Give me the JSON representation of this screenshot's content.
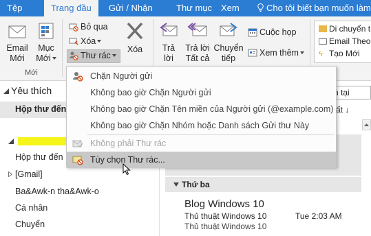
{
  "tabs": [
    "Tệp",
    "Trang đầu",
    "Gửi / Nhận",
    "Thư mục",
    "Xem"
  ],
  "tell_me": "Cho tôi biết bạn muốn làm",
  "ribbon": {
    "new_email": "Email\nMới",
    "new_items": "Mục\nMới",
    "group_new": "Mới",
    "ignore": "Bỏ qua",
    "clean_up": "Xóa",
    "junk": "Thư rác",
    "delete": "Xóa",
    "reply": "Trả\nlời",
    "reply_all": "Trả lời\nTất cả",
    "forward": "Chuyển\ntiếp",
    "meeting": "Cuộc họp",
    "more": "Xem thêm",
    "quick_steps": [
      "Di chuyển t",
      "Email Theo",
      "Tạo Mới"
    ]
  },
  "junk_menu": {
    "items": [
      {
        "label": "Chặn Người gửi",
        "state": "normal"
      },
      {
        "label": "Không bao giờ Chặn Người gửi",
        "state": "normal"
      },
      {
        "label": "Không bao giờ Chặn Tên miền của Người gửi (@example.com)",
        "state": "normal"
      },
      {
        "label": "Không bao giờ Chặn Nhóm hoặc Danh sách Gửi thư Này",
        "state": "normal"
      },
      {
        "label": "Không phải Thư rác",
        "state": "disabled"
      },
      {
        "label": "Tùy chọn Thư rác...",
        "state": "hover"
      }
    ]
  },
  "folders": {
    "favorites": "Yêu thích",
    "inbox_fav": "Hộp thư đến",
    "items": [
      "Hộp thư đến",
      "[Gmail]",
      "Ba&Awk-n tha&Awk-o",
      "Cá nhân",
      "Chuyển"
    ]
  },
  "message_list": {
    "filter": "n tại",
    "sort": "ất ↓",
    "group_header": "Thứ ba",
    "message": {
      "subject": "Blog Windows 10",
      "sender": "Thủ thuật Windows 10",
      "time": "Tue 2:03 AM",
      "preview": "Thủ thuật Windows 10"
    }
  },
  "colors": {
    "accent": "#2b7cd3",
    "ribbon_bg": "#f3f3f3",
    "highlight": "#f5f51a",
    "menu_hover": "#c8c8c8"
  }
}
